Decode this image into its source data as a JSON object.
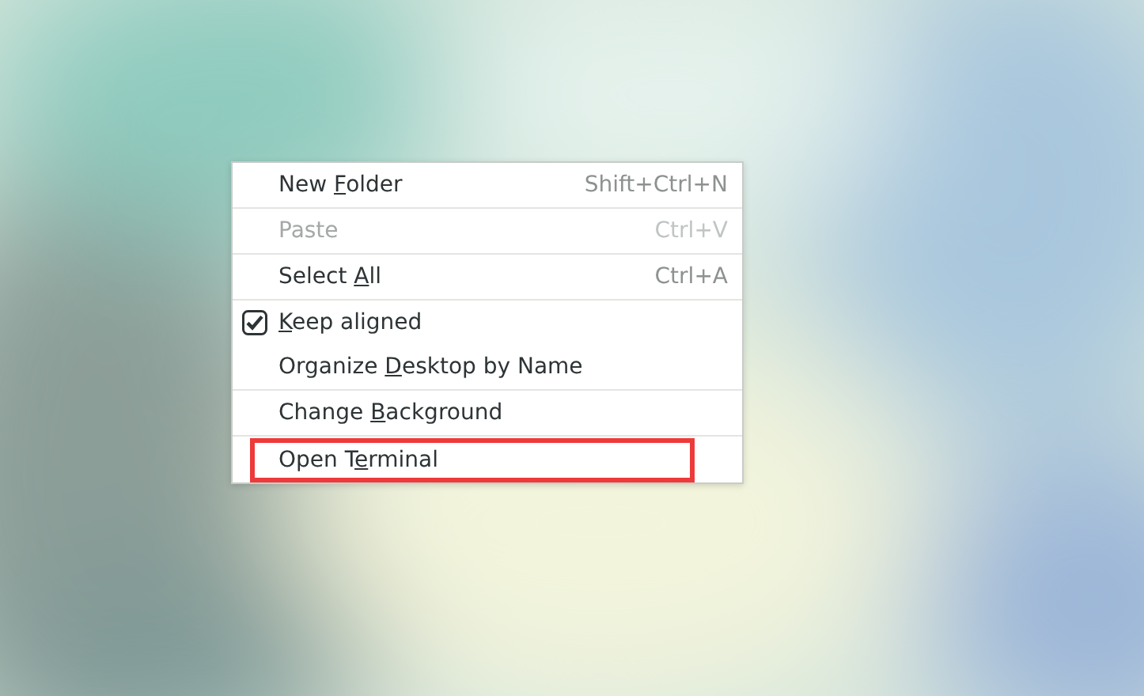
{
  "context_menu": {
    "groups": [
      {
        "items": [
          {
            "kind": "action",
            "before": "New ",
            "key": "F",
            "after": "older",
            "shortcut": "Shift+Ctrl+N",
            "disabled": false,
            "highlighted": false
          }
        ]
      },
      {
        "items": [
          {
            "kind": "action",
            "before": "Paste",
            "shortcut": "Ctrl+V",
            "disabled": true,
            "highlighted": false
          }
        ]
      },
      {
        "items": [
          {
            "kind": "action",
            "before": "Select ",
            "key": "A",
            "after": "ll",
            "shortcut": "Ctrl+A",
            "disabled": false,
            "highlighted": false
          }
        ]
      },
      {
        "items": [
          {
            "kind": "check",
            "key": "K",
            "after": "eep aligned",
            "checked": true,
            "disabled": false,
            "highlighted": false
          },
          {
            "kind": "action",
            "before": "Organize ",
            "key": "D",
            "after": "esktop by Name",
            "disabled": false,
            "highlighted": false
          }
        ]
      },
      {
        "items": [
          {
            "kind": "action",
            "before": "Change ",
            "key": "B",
            "after": "ackground",
            "disabled": false,
            "highlighted": false
          }
        ]
      },
      {
        "items": [
          {
            "kind": "action",
            "before": "Open T",
            "key": "e",
            "after": "rminal",
            "disabled": false,
            "highlighted": true
          }
        ]
      }
    ]
  }
}
